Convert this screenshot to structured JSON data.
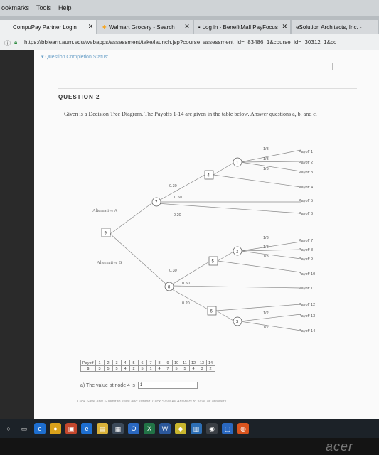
{
  "menubar": {
    "items": [
      "ookmarks",
      "Tools",
      "Help"
    ]
  },
  "tabs": [
    {
      "label": "CompuPay Partner Login",
      "active": true
    },
    {
      "label": "Walmart Grocery - Search",
      "active": false
    },
    {
      "label": "Log in - BenefitMall PayFocus",
      "active": false
    },
    {
      "label": "eSolution Architects, Inc. -",
      "active": false
    }
  ],
  "address": {
    "url": "https://bblearn.aum.edu/webapps/assessment/take/launch.jsp?course_assessment_id=_83486_1&course_id=_30312_1&co"
  },
  "page": {
    "completion": "Question Completion Status:",
    "question_title": "QUESTION 2",
    "question_text": "Given is a Decision Tree Diagram. The Payoffs 1-14 are given in the table below. Answer questions a, b, and c."
  },
  "tree": {
    "nodes": [
      {
        "label": "9",
        "type": "decision"
      },
      {
        "label": "7",
        "type": "chance"
      },
      {
        "label": "4",
        "type": "decision"
      },
      {
        "label": "1",
        "type": "chance"
      },
      {
        "label": "8",
        "type": "chance"
      },
      {
        "label": "5",
        "type": "decision"
      },
      {
        "label": "2",
        "type": "chance"
      },
      {
        "label": "6",
        "type": "decision"
      },
      {
        "label": "3",
        "type": "chance"
      }
    ],
    "alternatives": [
      "Alternative A",
      "Alternative B"
    ],
    "probabilities": {
      "node7": [
        "0.30",
        "0.50",
        "0.20"
      ],
      "node8": [
        "0.30",
        "0.50",
        "0.20"
      ],
      "node1": [
        "1/3",
        "1/3",
        "1/3"
      ],
      "node2": [
        "1/3",
        "1/3",
        "1/3"
      ],
      "node3": [
        "1/2",
        "1/2"
      ]
    },
    "payoffs": [
      "Payoff 1",
      "Payoff 2",
      "Payoff 3",
      "Payoff 4",
      "Payoff 5",
      "Payoff 6",
      "Payoff 7",
      "Payoff 8",
      "Payoff 9",
      "Payoff 10",
      "Payoff 11",
      "Payoff 12",
      "Payoff 13",
      "Payoff 14"
    ]
  },
  "payoff_table": {
    "header": [
      "Payoff",
      "1",
      "2",
      "3",
      "4",
      "5",
      "6",
      "7",
      "8",
      "9",
      "10",
      "11",
      "12",
      "13",
      "14"
    ],
    "row": [
      "$",
      "3",
      "5",
      "5",
      "4",
      "2",
      "5",
      "1",
      "4",
      "7",
      "5",
      "5",
      "4",
      "3",
      "2"
    ]
  },
  "answer": {
    "label": "a) The value at node 4 is",
    "value": "1"
  },
  "footer": "Click Save and Submit to save and submit. Click Save All Answers to save all answers.",
  "brand": "acer"
}
